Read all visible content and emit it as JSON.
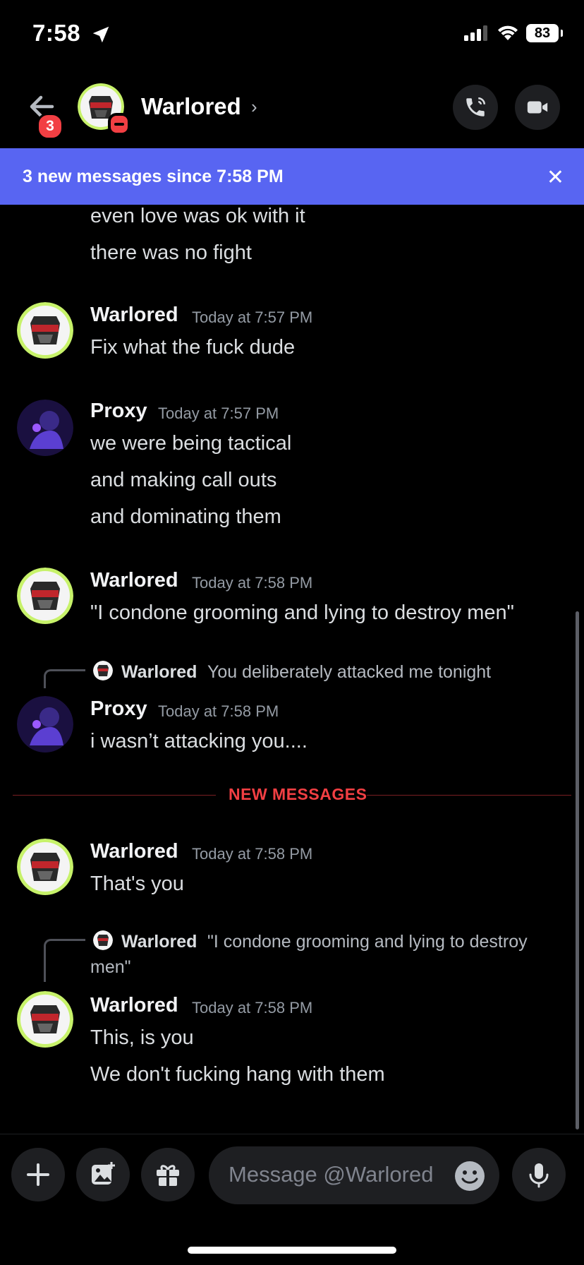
{
  "status": {
    "time": "7:58",
    "battery": "83"
  },
  "header": {
    "back_badge": "3",
    "name": "Warlored",
    "chevron": "›"
  },
  "banner": {
    "text": "3 new messages since 7:58 PM",
    "close": "✕"
  },
  "messages": [
    {
      "continuation": true,
      "lines": [
        "even love was ok with it",
        "there was no fight"
      ]
    },
    {
      "author": "Warlored",
      "time": "Today at 7:57 PM",
      "lines": [
        "Fix what the fuck dude"
      ]
    },
    {
      "author": "Proxy",
      "time": "Today at 7:57 PM",
      "lines": [
        "we were being tactical",
        "and making call outs",
        "and dominating them"
      ]
    },
    {
      "author": "Warlored",
      "time": "Today at 7:58 PM",
      "lines": [
        "\"I condone grooming and lying to destroy men\""
      ]
    },
    {
      "reply": {
        "author": "Warlored",
        "text": "You deliberately attacked me tonight"
      },
      "author": "Proxy",
      "time": "Today at 7:58 PM",
      "lines": [
        "i wasn’t attacking you...."
      ]
    },
    {
      "author": "Warlored",
      "time": "Today at 7:58 PM",
      "lines": [
        "That's you"
      ]
    },
    {
      "reply": {
        "author": "Warlored",
        "text": "\"I condone grooming and lying to destroy",
        "text2": "men\""
      },
      "author": "Warlored",
      "time": "Today at 7:58 PM",
      "lines": [
        "This, is you",
        "We don't fucking hang with them"
      ]
    }
  ],
  "new_messages_label": "NEW MESSAGES",
  "composer": {
    "placeholder": "Message @Warlored"
  },
  "colors": {
    "accent": "#5865f2",
    "danger": "#f23f43",
    "background": "#000000"
  },
  "icons": [
    "location-arrow-icon",
    "signal-icon",
    "wifi-icon",
    "back-arrow-icon",
    "call-icon",
    "video-icon",
    "close-icon",
    "plus-icon",
    "image-icon",
    "gift-icon",
    "emoji-icon",
    "microphone-icon"
  ]
}
